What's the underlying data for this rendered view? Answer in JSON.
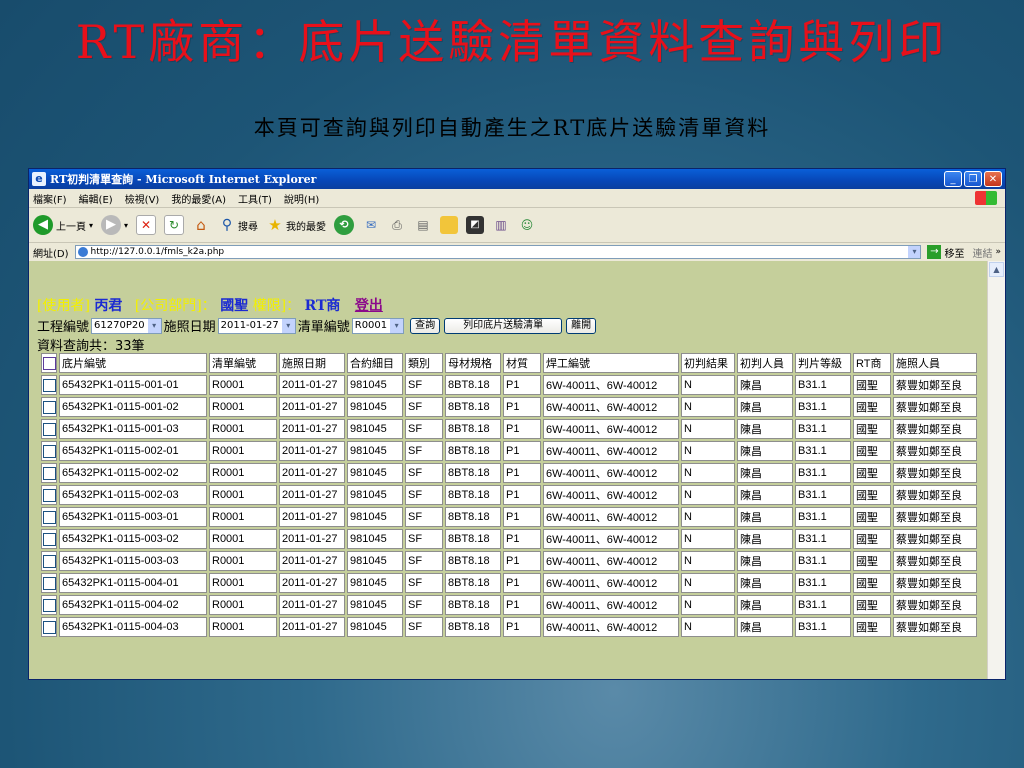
{
  "slide": {
    "title": "RT廠商：底片送驗清單資料查詢與列印",
    "subtitle": "本頁可查詢與列印自動產生之RT底片送驗清單資料"
  },
  "window": {
    "title": "RT初判清單查詢 - Microsoft Internet Explorer",
    "menu": [
      "檔案(F)",
      "編輯(E)",
      "檢視(V)",
      "我的最愛(A)",
      "工具(T)",
      "說明(H)"
    ],
    "toolbar": {
      "back": "上一頁",
      "search": "搜尋",
      "favorites": "我的最愛"
    },
    "address_label": "網址(D)",
    "address_url": "http://127.0.0.1/fmls_k2a.php",
    "go_label": "移至",
    "links_label": "連結"
  },
  "page": {
    "user_label": "[使用者]",
    "user_name": "丙君",
    "dept_label": "[公司部門]：",
    "dept_name": "國聖",
    "role_label": "權限]：",
    "role_name": "RT商",
    "logout": "登出",
    "filters": {
      "project_label": "工程編號",
      "project_value": "61270P20",
      "date_label": "施照日期",
      "date_value": "2011-01-27",
      "list_label": "清單編號",
      "list_value": "R0001",
      "query_button": "查詢",
      "print_button": "列印底片送驗清單",
      "exit_button": "離開"
    },
    "count_text": "資料查詢共：33筆",
    "columns": [
      "底片編號",
      "清單編號",
      "施照日期",
      "合約細目",
      "類別",
      "母材規格",
      "材質",
      "焊工編號",
      "初判結果",
      "初判人員",
      "判片等級",
      "RT商",
      "施照人員"
    ],
    "rows": [
      [
        "65432PK1-0115-001-01",
        "R0001",
        "2011-01-27",
        "981045",
        "SF",
        "8BT8.18",
        "P1",
        "6W-40011、6W-40012",
        "N",
        "陳昌",
        "B31.1",
        "國聖",
        "蔡豐如鄭至良"
      ],
      [
        "65432PK1-0115-001-02",
        "R0001",
        "2011-01-27",
        "981045",
        "SF",
        "8BT8.18",
        "P1",
        "6W-40011、6W-40012",
        "N",
        "陳昌",
        "B31.1",
        "國聖",
        "蔡豐如鄭至良"
      ],
      [
        "65432PK1-0115-001-03",
        "R0001",
        "2011-01-27",
        "981045",
        "SF",
        "8BT8.18",
        "P1",
        "6W-40011、6W-40012",
        "N",
        "陳昌",
        "B31.1",
        "國聖",
        "蔡豐如鄭至良"
      ],
      [
        "65432PK1-0115-002-01",
        "R0001",
        "2011-01-27",
        "981045",
        "SF",
        "8BT8.18",
        "P1",
        "6W-40011、6W-40012",
        "N",
        "陳昌",
        "B31.1",
        "國聖",
        "蔡豐如鄭至良"
      ],
      [
        "65432PK1-0115-002-02",
        "R0001",
        "2011-01-27",
        "981045",
        "SF",
        "8BT8.18",
        "P1",
        "6W-40011、6W-40012",
        "N",
        "陳昌",
        "B31.1",
        "國聖",
        "蔡豐如鄭至良"
      ],
      [
        "65432PK1-0115-002-03",
        "R0001",
        "2011-01-27",
        "981045",
        "SF",
        "8BT8.18",
        "P1",
        "6W-40011、6W-40012",
        "N",
        "陳昌",
        "B31.1",
        "國聖",
        "蔡豐如鄭至良"
      ],
      [
        "65432PK1-0115-003-01",
        "R0001",
        "2011-01-27",
        "981045",
        "SF",
        "8BT8.18",
        "P1",
        "6W-40011、6W-40012",
        "N",
        "陳昌",
        "B31.1",
        "國聖",
        "蔡豐如鄭至良"
      ],
      [
        "65432PK1-0115-003-02",
        "R0001",
        "2011-01-27",
        "981045",
        "SF",
        "8BT8.18",
        "P1",
        "6W-40011、6W-40012",
        "N",
        "陳昌",
        "B31.1",
        "國聖",
        "蔡豐如鄭至良"
      ],
      [
        "65432PK1-0115-003-03",
        "R0001",
        "2011-01-27",
        "981045",
        "SF",
        "8BT8.18",
        "P1",
        "6W-40011、6W-40012",
        "N",
        "陳昌",
        "B31.1",
        "國聖",
        "蔡豐如鄭至良"
      ],
      [
        "65432PK1-0115-004-01",
        "R0001",
        "2011-01-27",
        "981045",
        "SF",
        "8BT8.18",
        "P1",
        "6W-40011、6W-40012",
        "N",
        "陳昌",
        "B31.1",
        "國聖",
        "蔡豐如鄭至良"
      ],
      [
        "65432PK1-0115-004-02",
        "R0001",
        "2011-01-27",
        "981045",
        "SF",
        "8BT8.18",
        "P1",
        "6W-40011、6W-40012",
        "N",
        "陳昌",
        "B31.1",
        "國聖",
        "蔡豐如鄭至良"
      ],
      [
        "65432PK1-0115-004-03",
        "R0001",
        "2011-01-27",
        "981045",
        "SF",
        "8BT8.18",
        "P1",
        "6W-40011、6W-40012",
        "N",
        "陳昌",
        "B31.1",
        "國聖",
        "蔡豐如鄭至良"
      ]
    ]
  },
  "colors": {
    "slide_title": "#e8101a",
    "content_bg": "#c5cf9b",
    "user_label": "#f3f000",
    "user_name": "#1b2ad2",
    "logout": "#8b0a8b"
  }
}
